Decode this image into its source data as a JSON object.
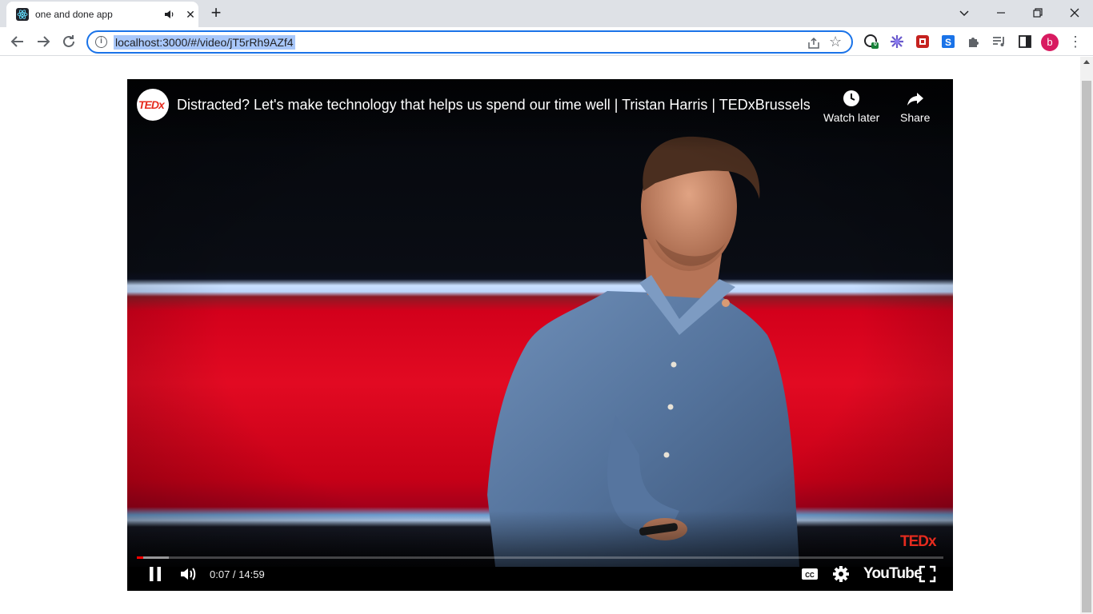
{
  "browser": {
    "tab_title": "one and done app",
    "tab_close": "✕",
    "new_tab": "+",
    "window_controls": {
      "dropdown": "⌄",
      "minimize": "—",
      "restore": "❐",
      "close": "✕"
    },
    "url": "localhost:3000/#/video/jT5rRh9AZf4",
    "info_glyph": "i",
    "star_glyph": "☆",
    "profile_initial": "b",
    "menu_glyph": "⋮",
    "extension_badge": "0",
    "accent_color": "#1a73e8"
  },
  "player": {
    "channel": "TEDx",
    "title": "Distracted? Let's make technology that helps us spend our time well | Tristan Harris | TEDxBrussels",
    "actions": [
      {
        "label": "Watch later",
        "icon": "clock-icon"
      },
      {
        "label": "Share",
        "icon": "share-arrow-icon"
      }
    ],
    "watermark": "TEDx",
    "current_time": "0:07",
    "duration": "14:59",
    "time_display": "0:07 / 14:59",
    "progress_fraction": 0.0078,
    "buffered_fraction": 0.04,
    "youtube_logo": "YouTube",
    "state": "playing",
    "progress_color": "#ff0000"
  }
}
